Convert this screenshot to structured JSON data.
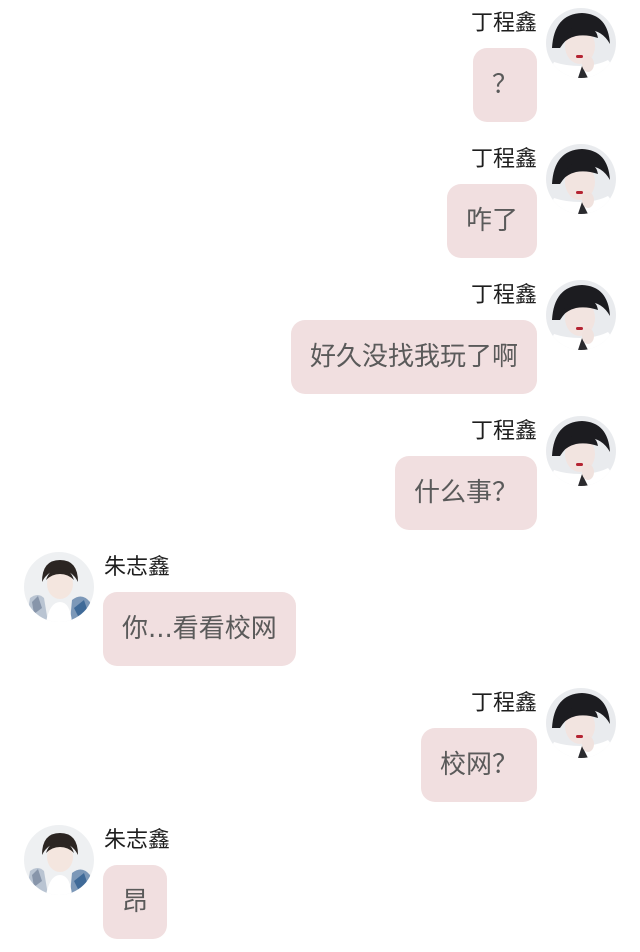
{
  "users": {
    "me": {
      "name": "丁程鑫",
      "avatar_icon": "user-avatar-icon"
    },
    "other": {
      "name": "朱志鑫",
      "avatar_icon": "user-avatar-icon"
    }
  },
  "colors": {
    "background": "#ffffff",
    "bubble": "#f1dfe0",
    "bubble_text": "#5a5a5a",
    "name_text": "#1e1e1e"
  },
  "messages": [
    {
      "side": "right",
      "sender": "丁程鑫",
      "text": "？"
    },
    {
      "side": "right",
      "sender": "丁程鑫",
      "text": "咋了"
    },
    {
      "side": "right",
      "sender": "丁程鑫",
      "text": "好久没找我玩了啊"
    },
    {
      "side": "right",
      "sender": "丁程鑫",
      "text": "什么事？"
    },
    {
      "side": "left",
      "sender": "朱志鑫",
      "text": "你...看看校网"
    },
    {
      "side": "right",
      "sender": "丁程鑫",
      "text": "校网？"
    },
    {
      "side": "left",
      "sender": "朱志鑫",
      "text": "昂"
    }
  ]
}
